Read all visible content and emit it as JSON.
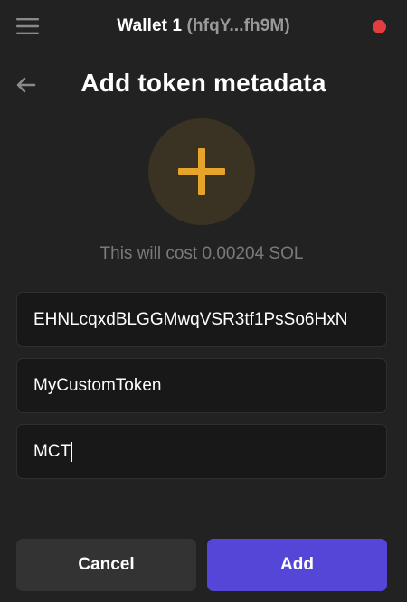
{
  "header": {
    "wallet_name": "Wallet 1",
    "wallet_address": "(hfqY...fh9M)",
    "status_color": "#e33e3f"
  },
  "page": {
    "title": "Add token metadata",
    "cost_text": "This will cost 0.00204 SOL"
  },
  "form": {
    "mint_address": "EHNLcqxdBLGGMwqVSR3tf1PsSo6HxN",
    "token_name": "MyCustomToken",
    "token_symbol": "MCT"
  },
  "actions": {
    "cancel_label": "Cancel",
    "add_label": "Add"
  },
  "colors": {
    "accent": "#5446d6",
    "plus_icon": "#e6a52a"
  },
  "icons": {
    "menu": "hamburger-icon",
    "back": "arrow-left-icon",
    "plus": "plus-icon"
  }
}
